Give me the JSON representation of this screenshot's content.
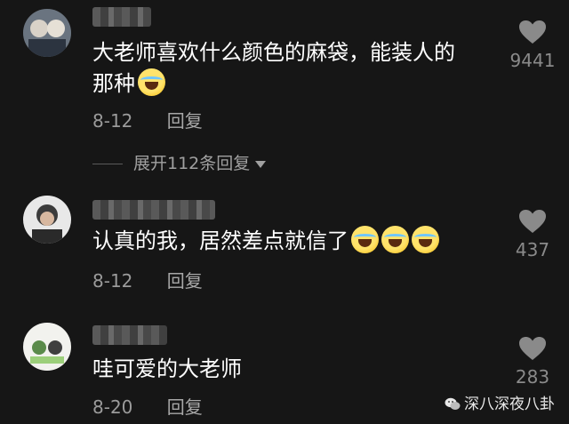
{
  "comments": [
    {
      "text_line1": "大老师喜欢什么颜色的麻袋，能装人的",
      "text_line2": "那种",
      "date": "8-12",
      "reply_label": "回复",
      "like_count": "9441",
      "emoji_icons": [
        "laughing-tears-emoji"
      ]
    },
    {
      "text_line1": "认真的我，居然差点就信了",
      "date": "8-12",
      "reply_label": "回复",
      "like_count": "437",
      "emoji_icons": [
        "laughing-tears-emoji",
        "laughing-tears-emoji",
        "laughing-tears-emoji"
      ]
    },
    {
      "text_line1": "哇可爱的大老师",
      "date": "8-20",
      "reply_label": "回复",
      "like_count": "283",
      "emoji_icons": []
    }
  ],
  "expand_replies": {
    "label": "展开112条回复"
  },
  "watermark": {
    "text": "深八深夜八卦",
    "icon": "wechat-icon"
  },
  "colors": {
    "background": "#161616",
    "text": "#ffffff",
    "meta": "#9b9b9b",
    "heart": "#8a8a8a"
  }
}
